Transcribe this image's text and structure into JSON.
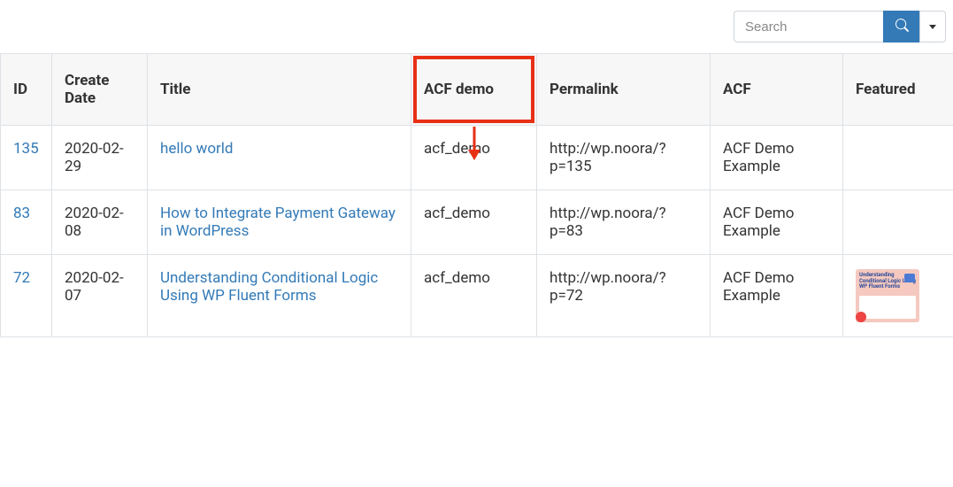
{
  "search": {
    "placeholder": "Search",
    "value": ""
  },
  "columns": {
    "id": "ID",
    "date": "Create Date",
    "title": "Title",
    "acfdemo": "ACF demo",
    "permalink": "Permalink",
    "acf": "ACF",
    "featured": "Featured"
  },
  "rows": [
    {
      "id": "135",
      "date": "2020-02-29",
      "title": "hello world",
      "acfdemo": "acf_demo",
      "permalink": "http://wp.noora/?p=135",
      "acf": "ACF Demo Example",
      "featured": ""
    },
    {
      "id": "83",
      "date": "2020-02-08",
      "title": "How to Integrate Payment Gateway in WordPress",
      "acfdemo": "acf_demo",
      "permalink": "http://wp.noora/?p=83",
      "acf": "ACF Demo Example",
      "featured": ""
    },
    {
      "id": "72",
      "date": "2020-02-07",
      "title": "Understanding Conditional Logic Using WP Fluent Forms",
      "acfdemo": "acf_demo",
      "permalink": "http://wp.noora/?p=72",
      "acf": "ACF Demo Example",
      "featured": "thumb"
    }
  ],
  "thumb_text": "Understanding Conditional Logic Using WP Fluent Forms"
}
